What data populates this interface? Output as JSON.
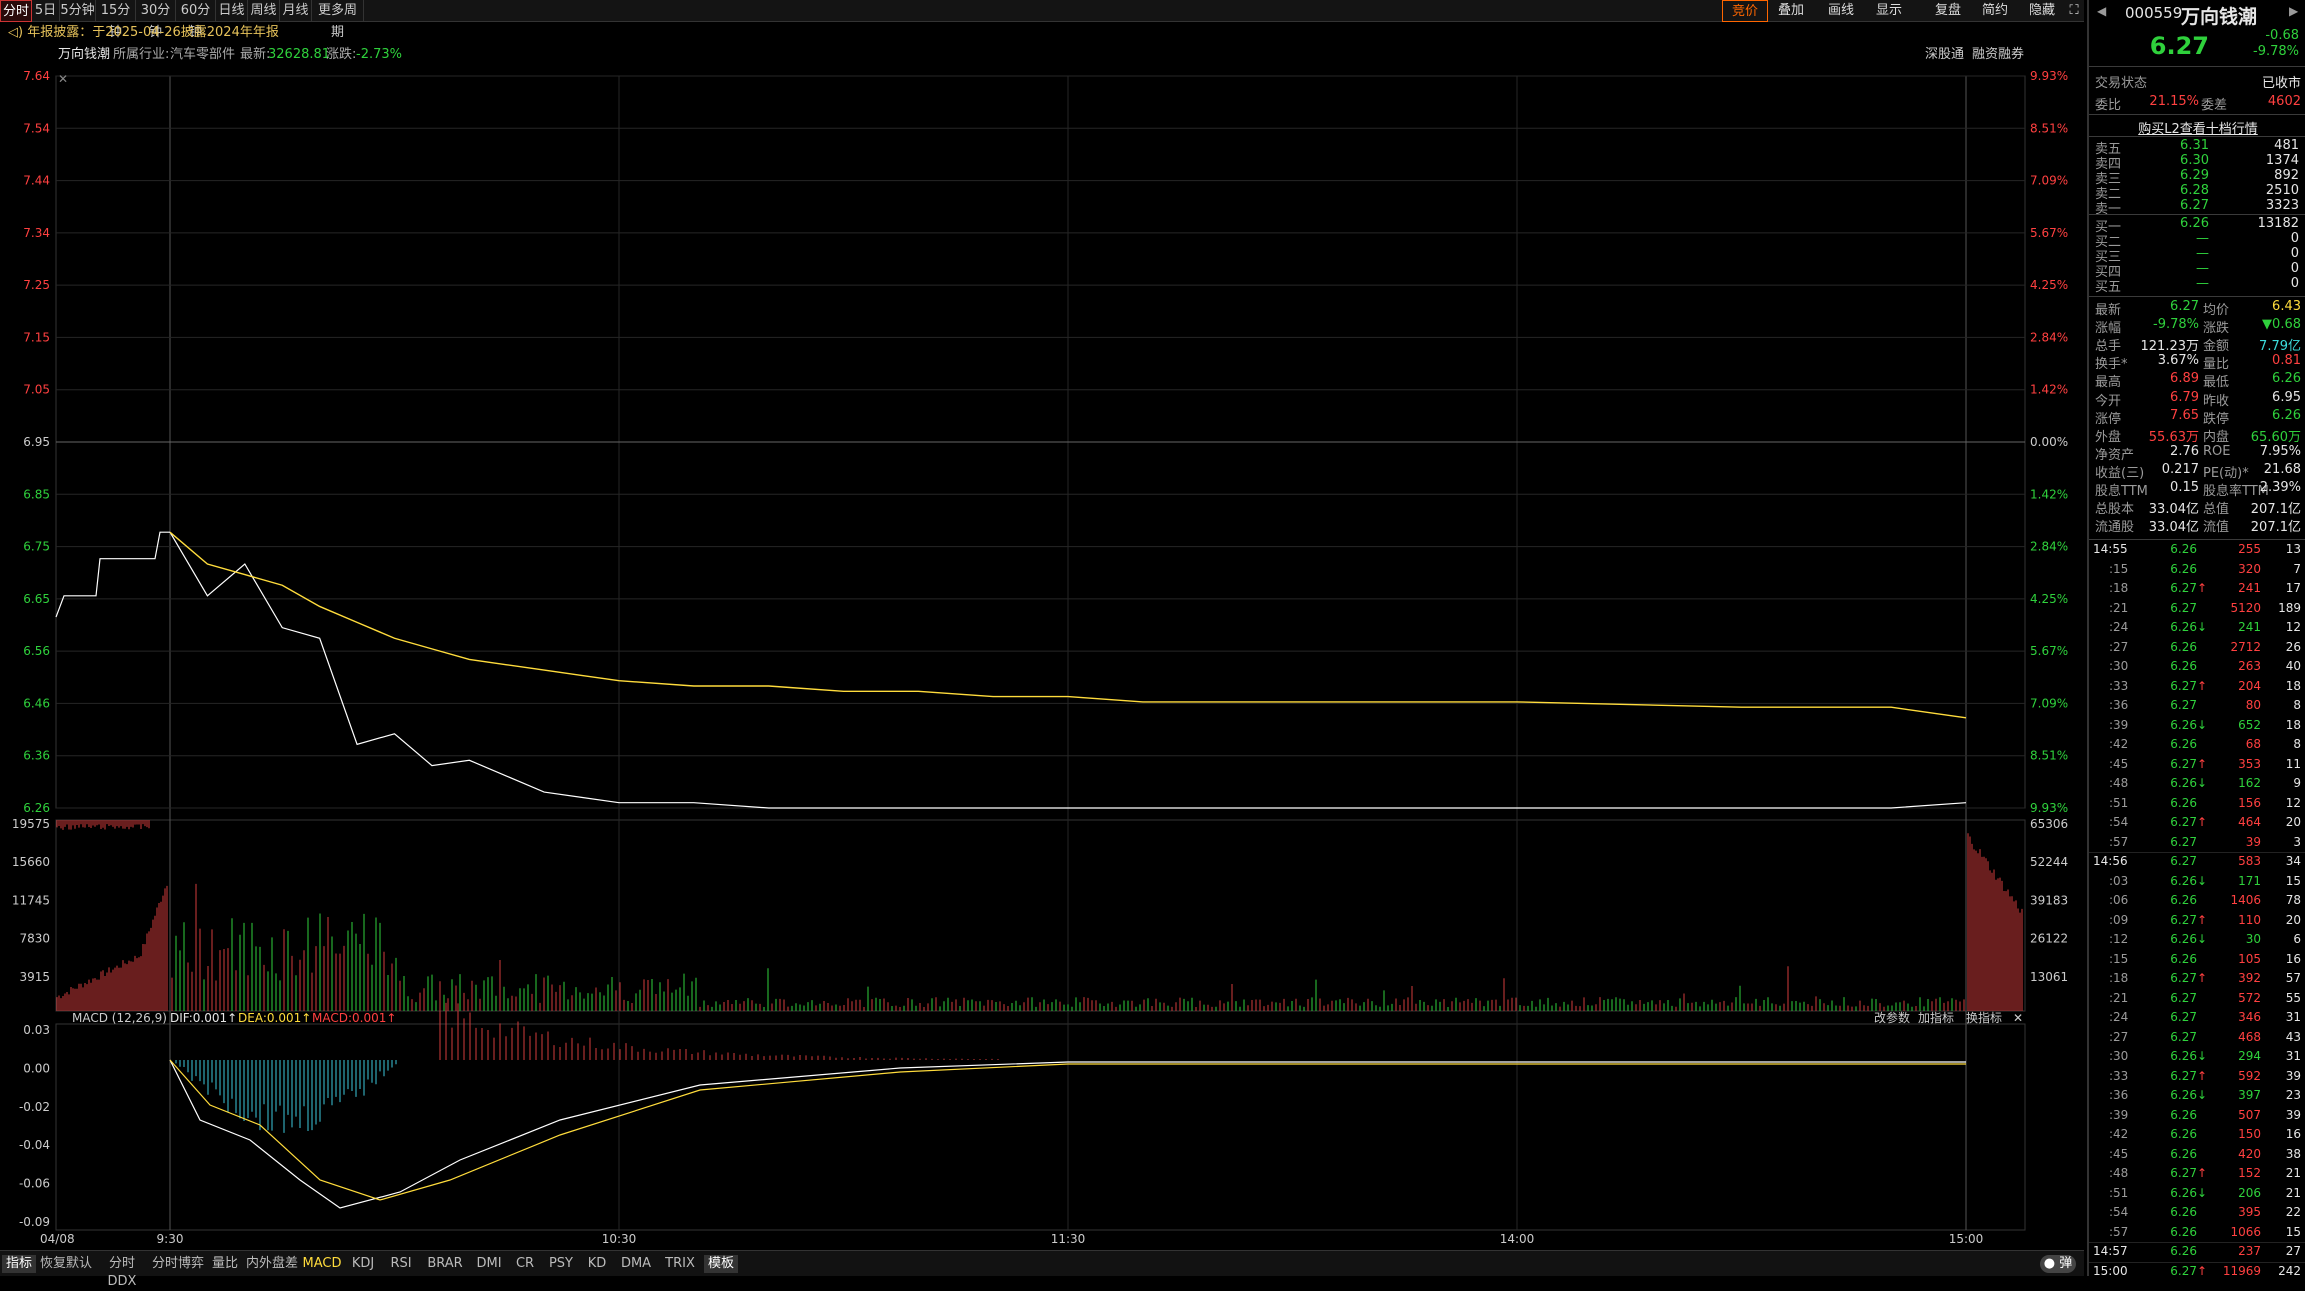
{
  "tabs": [
    {
      "label": "分时"
    },
    {
      "label": "5日"
    },
    {
      "label": "5分钟"
    },
    {
      "label": "15分钟"
    },
    {
      "label": "30分钟"
    },
    {
      "label": "60分钟"
    },
    {
      "label": "日线"
    },
    {
      "label": "周线"
    },
    {
      "label": "月线"
    },
    {
      "label": "更多周期"
    }
  ],
  "right_tools": [
    {
      "label": "竞价"
    },
    {
      "label": "叠加"
    },
    {
      "label": "画线"
    },
    {
      "label": "显示"
    },
    {
      "label": "复盘"
    },
    {
      "label": "简约"
    },
    {
      "label": "隐藏"
    }
  ],
  "notice": "年报披露：于2025-04-26披露2024年年报",
  "info": {
    "stock_name": "万向钱潮",
    "industry_label": "所属行业:",
    "industry": "汽车零部件",
    "latest_label": "最新:",
    "latest": "32628.81",
    "change_label": "涨跌:",
    "change": "-2.73%",
    "link1": "深股通",
    "link2": "融资融券"
  },
  "price_axis": {
    "left": [
      "7.64",
      "7.54",
      "7.44",
      "7.34",
      "7.25",
      "7.15",
      "7.05",
      "6.95",
      "6.85",
      "6.75",
      "6.65",
      "6.56",
      "6.46",
      "6.36",
      "6.26"
    ],
    "right": [
      "9.93%",
      "8.51%",
      "7.09%",
      "5.67%",
      "4.25%",
      "2.84%",
      "1.42%",
      "0.00%",
      "1.42%",
      "2.84%",
      "4.25%",
      "5.67%",
      "7.09%",
      "8.51%",
      "9.93%"
    ]
  },
  "volume_axis": {
    "left": [
      "19575",
      "15660",
      "11745",
      "7830",
      "3915"
    ],
    "right": [
      "65306",
      "52244",
      "39183",
      "26122",
      "13061"
    ]
  },
  "macd": {
    "label": "MACD (12,26,9)",
    "dif": "DIF:0.001",
    "dea": "DEA:0.001",
    "macd": "MACD:0.001",
    "axis": [
      "0.03",
      "0.00",
      "-0.02",
      "-0.04",
      "-0.06",
      "-0.09"
    ],
    "btn1": "改参数",
    "btn2": "加指标",
    "btn3": "换指标"
  },
  "time_axis": [
    "04/08",
    "9:30",
    "10:30",
    "11:30",
    "14:00",
    "15:00"
  ],
  "bottom_tabs": [
    {
      "label": "指标"
    },
    {
      "label": "恢复默认"
    },
    {
      "label": "分时DDX"
    },
    {
      "label": "分时博弈"
    },
    {
      "label": "量比"
    },
    {
      "label": "内外盘差"
    },
    {
      "label": "MACD"
    },
    {
      "label": "KDJ"
    },
    {
      "label": "RSI"
    },
    {
      "label": "BRAR"
    },
    {
      "label": "DMI"
    },
    {
      "label": "CR"
    },
    {
      "label": "PSY"
    },
    {
      "label": "KD"
    },
    {
      "label": "DMA"
    },
    {
      "label": "TRIX"
    },
    {
      "label": "模板"
    }
  ],
  "bottom_right": "弹",
  "stock": {
    "code": "000559",
    "name": "万向钱潮",
    "price": "6.27",
    "change": "-0.68",
    "pct": "-9.78%"
  },
  "status": {
    "label": "交易状态",
    "value": "已收市"
  },
  "ratio": {
    "wb_label": "委比",
    "wb": "21.15%",
    "wc_label": "委差",
    "wc": "4602"
  },
  "l2_link": "购买L2查看十档行情",
  "asks": [
    {
      "label": "卖五",
      "price": "6.31",
      "vol": "481"
    },
    {
      "label": "卖四",
      "price": "6.30",
      "vol": "1374"
    },
    {
      "label": "卖三",
      "price": "6.29",
      "vol": "892"
    },
    {
      "label": "卖二",
      "price": "6.28",
      "vol": "2510"
    },
    {
      "label": "卖一",
      "price": "6.27",
      "vol": "3323"
    }
  ],
  "bids": [
    {
      "label": "买一",
      "price": "6.26",
      "vol": "13182"
    },
    {
      "label": "买二",
      "price": "—",
      "vol": "0"
    },
    {
      "label": "买三",
      "price": "—",
      "vol": "0"
    },
    {
      "label": "买四",
      "price": "—",
      "vol": "0"
    },
    {
      "label": "买五",
      "price": "—",
      "vol": "0"
    }
  ],
  "stats": [
    {
      "l1": "最新",
      "v1": "6.27",
      "l2": "均价",
      "v2": "6.43"
    },
    {
      "l1": "涨幅",
      "v1": "-9.78%",
      "l2": "涨跌",
      "v2": "▼0.68"
    },
    {
      "l1": "总手",
      "v1": "121.23万",
      "l2": "金额",
      "v2": "7.79亿"
    },
    {
      "l1": "换手*",
      "v1": "3.67%",
      "l2": "量比",
      "v2": "0.81"
    },
    {
      "l1": "最高",
      "v1": "6.89",
      "l2": "最低",
      "v2": "6.26"
    },
    {
      "l1": "今开",
      "v1": "6.79",
      "l2": "昨收",
      "v2": "6.95"
    },
    {
      "l1": "涨停",
      "v1": "7.65",
      "l2": "跌停",
      "v2": "6.26"
    },
    {
      "l1": "外盘",
      "v1": "55.63万",
      "l2": "内盘",
      "v2": "65.60万"
    },
    {
      "l1": "净资产",
      "v1": "2.76",
      "l2": "ROE",
      "v2": "7.95%"
    },
    {
      "l1": "收益(三)",
      "v1": "0.217",
      "l2": "PE(动)*",
      "v2": "21.68"
    },
    {
      "l1": "股息TTM",
      "v1": "0.15",
      "l2": "股息率TTM",
      "v2": "2.39%"
    },
    {
      "l1": "总股本",
      "v1": "33.04亿",
      "l2": "总值",
      "v2": "207.1亿"
    },
    {
      "l1": "流通股",
      "v1": "33.04亿",
      "l2": "流值",
      "v2": "207.1亿"
    }
  ],
  "ticks": [
    {
      "t": "14:55",
      "p": "6.26",
      "a": "",
      "v": "255",
      "n": "13"
    },
    {
      "t": ":15",
      "p": "6.26",
      "a": "",
      "v": "320",
      "n": "7"
    },
    {
      "t": ":18",
      "p": "6.27",
      "a": "↑",
      "v": "241",
      "n": "17"
    },
    {
      "t": ":21",
      "p": "6.27",
      "a": "",
      "v": "5120",
      "n": "189"
    },
    {
      "t": ":24",
      "p": "6.26",
      "a": "↓",
      "v": "241",
      "n": "12"
    },
    {
      "t": ":27",
      "p": "6.26",
      "a": "",
      "v": "2712",
      "n": "26"
    },
    {
      "t": ":30",
      "p": "6.26",
      "a": "",
      "v": "263",
      "n": "40"
    },
    {
      "t": ":33",
      "p": "6.27",
      "a": "↑",
      "v": "204",
      "n": "18"
    },
    {
      "t": ":36",
      "p": "6.27",
      "a": "",
      "v": "80",
      "n": "8"
    },
    {
      "t": ":39",
      "p": "6.26",
      "a": "↓",
      "v": "652",
      "n": "18"
    },
    {
      "t": ":42",
      "p": "6.26",
      "a": "",
      "v": "68",
      "n": "8"
    },
    {
      "t": ":45",
      "p": "6.27",
      "a": "↑",
      "v": "353",
      "n": "11"
    },
    {
      "t": ":48",
      "p": "6.26",
      "a": "↓",
      "v": "162",
      "n": "9"
    },
    {
      "t": ":51",
      "p": "6.26",
      "a": "",
      "v": "156",
      "n": "12"
    },
    {
      "t": ":54",
      "p": "6.27",
      "a": "↑",
      "v": "464",
      "n": "20"
    },
    {
      "t": ":57",
      "p": "6.27",
      "a": "",
      "v": "39",
      "n": "3"
    },
    {
      "t": "14:56",
      "p": "6.27",
      "a": "",
      "v": "583",
      "n": "34"
    },
    {
      "t": ":03",
      "p": "6.26",
      "a": "↓",
      "v": "171",
      "n": "15"
    },
    {
      "t": ":06",
      "p": "6.26",
      "a": "",
      "v": "1406",
      "n": "78"
    },
    {
      "t": ":09",
      "p": "6.27",
      "a": "↑",
      "v": "110",
      "n": "20"
    },
    {
      "t": ":12",
      "p": "6.26",
      "a": "↓",
      "v": "30",
      "n": "6"
    },
    {
      "t": ":15",
      "p": "6.26",
      "a": "",
      "v": "105",
      "n": "16"
    },
    {
      "t": ":18",
      "p": "6.27",
      "a": "↑",
      "v": "392",
      "n": "57"
    },
    {
      "t": ":21",
      "p": "6.27",
      "a": "",
      "v": "572",
      "n": "55"
    },
    {
      "t": ":24",
      "p": "6.27",
      "a": "",
      "v": "346",
      "n": "31"
    },
    {
      "t": ":27",
      "p": "6.27",
      "a": "",
      "v": "468",
      "n": "43"
    },
    {
      "t": ":30",
      "p": "6.26",
      "a": "↓",
      "v": "294",
      "n": "31"
    },
    {
      "t": ":33",
      "p": "6.27",
      "a": "↑",
      "v": "592",
      "n": "39"
    },
    {
      "t": ":36",
      "p": "6.26",
      "a": "↓",
      "v": "397",
      "n": "23"
    },
    {
      "t": ":39",
      "p": "6.26",
      "a": "",
      "v": "507",
      "n": "39"
    },
    {
      "t": ":42",
      "p": "6.26",
      "a": "",
      "v": "150",
      "n": "16"
    },
    {
      "t": ":45",
      "p": "6.26",
      "a": "",
      "v": "420",
      "n": "38"
    },
    {
      "t": ":48",
      "p": "6.27",
      "a": "↑",
      "v": "152",
      "n": "21"
    },
    {
      "t": ":51",
      "p": "6.26",
      "a": "↓",
      "v": "206",
      "n": "21"
    },
    {
      "t": ":54",
      "p": "6.26",
      "a": "",
      "v": "395",
      "n": "22"
    },
    {
      "t": ":57",
      "p": "6.26",
      "a": "",
      "v": "1066",
      "n": "15"
    },
    {
      "t": "14:57",
      "p": "6.26",
      "a": "",
      "v": "237",
      "n": "27"
    },
    {
      "t": "15:00",
      "p": "6.27",
      "a": "↑",
      "v": "11969",
      "n": "242"
    }
  ],
  "chart_data": {
    "type": "line",
    "title": "",
    "prev_close": 6.95,
    "ylim": [
      6.26,
      7.64
    ],
    "x": [
      "9:30",
      "9:35",
      "9:40",
      "9:45",
      "9:50",
      "9:55",
      "10:00",
      "10:05",
      "10:10",
      "10:15",
      "10:20",
      "10:25",
      "10:30",
      "10:40",
      "10:50",
      "11:00",
      "11:10",
      "11:20",
      "11:30",
      "13:10",
      "13:30",
      "14:00",
      "14:30",
      "14:50",
      "15:00"
    ],
    "series": [
      {
        "values": [
          6.78,
          6.66,
          6.72,
          6.6,
          6.58,
          6.38,
          6.4,
          6.34,
          6.35,
          6.32,
          6.29,
          6.28,
          6.27,
          6.27,
          6.26,
          6.26,
          6.26,
          6.26,
          6.26,
          6.26,
          6.26,
          6.26,
          6.26,
          6.26,
          6.27
        ]
      },
      {
        "values": [
          6.78,
          6.72,
          6.7,
          6.68,
          6.64,
          6.61,
          6.58,
          6.56,
          6.54,
          6.53,
          6.52,
          6.51,
          6.5,
          6.49,
          6.49,
          6.48,
          6.48,
          6.47,
          6.47,
          6.46,
          6.46,
          6.46,
          6.45,
          6.45,
          6.43
        ]
      }
    ]
  }
}
